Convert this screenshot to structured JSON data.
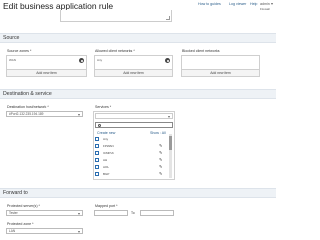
{
  "page": {
    "title": "Edit business application rule"
  },
  "topnav": {
    "items": [
      "How to guides",
      "Log viewer",
      "Help"
    ],
    "user": "admin",
    "user_sub": "Firewall"
  },
  "source": {
    "section_title": "Source",
    "zones_label": "Source zones *",
    "zones_value": "WAN",
    "networks_label": "Allowed client networks *",
    "networks_value": "Any",
    "blocked_label": "Blocked client networks",
    "add_label": "Add new item"
  },
  "dest": {
    "section_title": "Destination & service",
    "host_label": "Destination host/network *",
    "host_value": "#Port2-132.235.194.189",
    "services_label": "Services *",
    "create_new": "Create new",
    "show_all": "Show : All",
    "services": [
      "Any",
      "FPWAN",
      "ICMPv6",
      "AH",
      "AOL",
      "BGP"
    ]
  },
  "forward": {
    "section_title": "Forward to",
    "protected_server_label": "Protected server(s) *",
    "protected_server_value": "Tester",
    "protected_zone_label": "Protected zone *",
    "protected_zone_value": "LAN",
    "mapped_port_label": "Mapped port *",
    "to_label": "To"
  },
  "colors": {
    "link": "#2a5d8a",
    "section_bg": "#eef2f6",
    "checkbox": "#2a6db0"
  }
}
